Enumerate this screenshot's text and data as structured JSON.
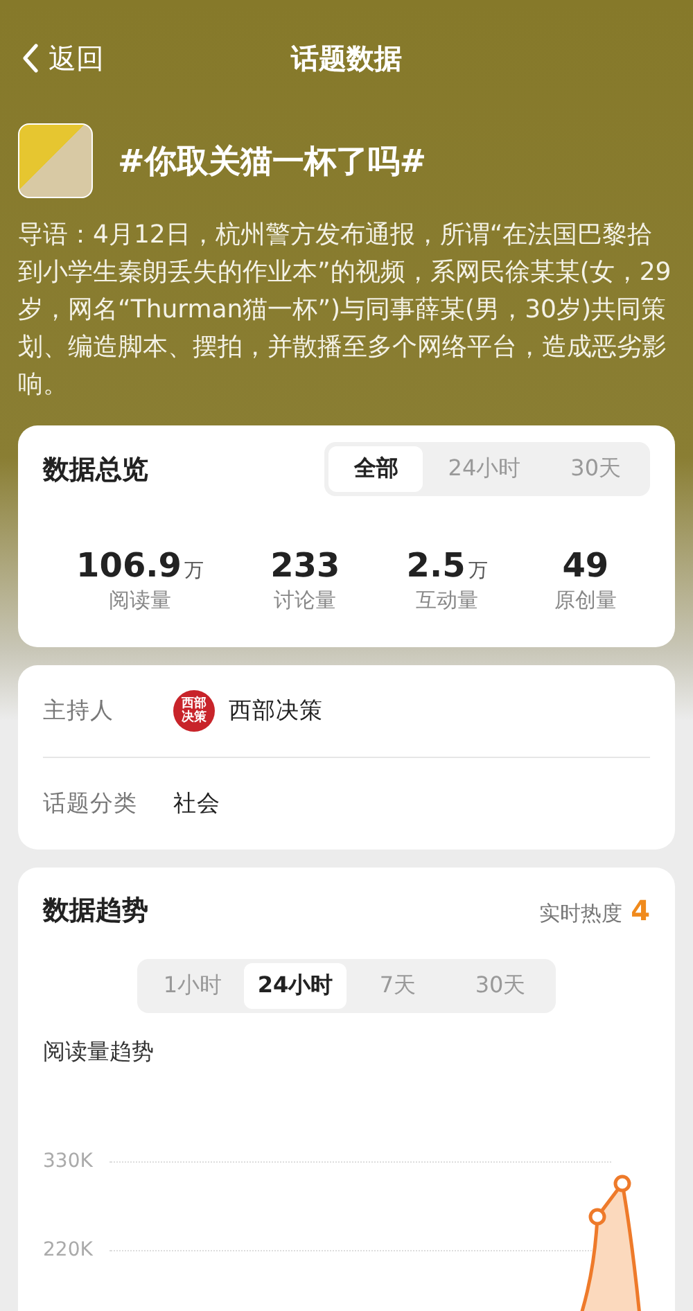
{
  "nav": {
    "back_label": "返回",
    "title": "话题数据"
  },
  "topic": {
    "title": "#你取关猫一杯了吗#",
    "intro": "导语：4月12日，杭州警方发布通报，所谓“在法国巴黎拾到小学生秦朗丢失的作业本”的视频，系网民徐某某(女，29岁，网名“Thurman猫一杯”)与同事薛某(男，30岁)共同策划、编造脚本、摆拍，并散播至多个网络平台，造成恶劣影响。"
  },
  "overview": {
    "title": "数据总览",
    "tabs": [
      {
        "label": "全部",
        "selected": true
      },
      {
        "label": "24小时",
        "selected": false
      },
      {
        "label": "30天",
        "selected": false
      }
    ],
    "stats": [
      {
        "value": "106.9",
        "unit": "万",
        "label": "阅读量"
      },
      {
        "value": "233",
        "label": "讨论量"
      },
      {
        "value": "2.5",
        "unit": "万",
        "label": "互动量"
      },
      {
        "value": "49",
        "label": "原创量"
      }
    ]
  },
  "info": {
    "host_label": "主持人",
    "host_logo_text": "西部决策",
    "host_name": "西部决策",
    "category_label": "话题分类",
    "category": "社会"
  },
  "trend": {
    "title": "数据趋势",
    "heat_label": "实时热度",
    "heat_value": "4",
    "tabs": [
      {
        "label": "1小时",
        "selected": false
      },
      {
        "label": "24小时",
        "selected": true
      },
      {
        "label": "7天",
        "selected": false
      },
      {
        "label": "30天",
        "selected": false
      }
    ],
    "chart_title": "阅读量趋势",
    "y_axis_labels": [
      "330K",
      "220K"
    ]
  }
}
